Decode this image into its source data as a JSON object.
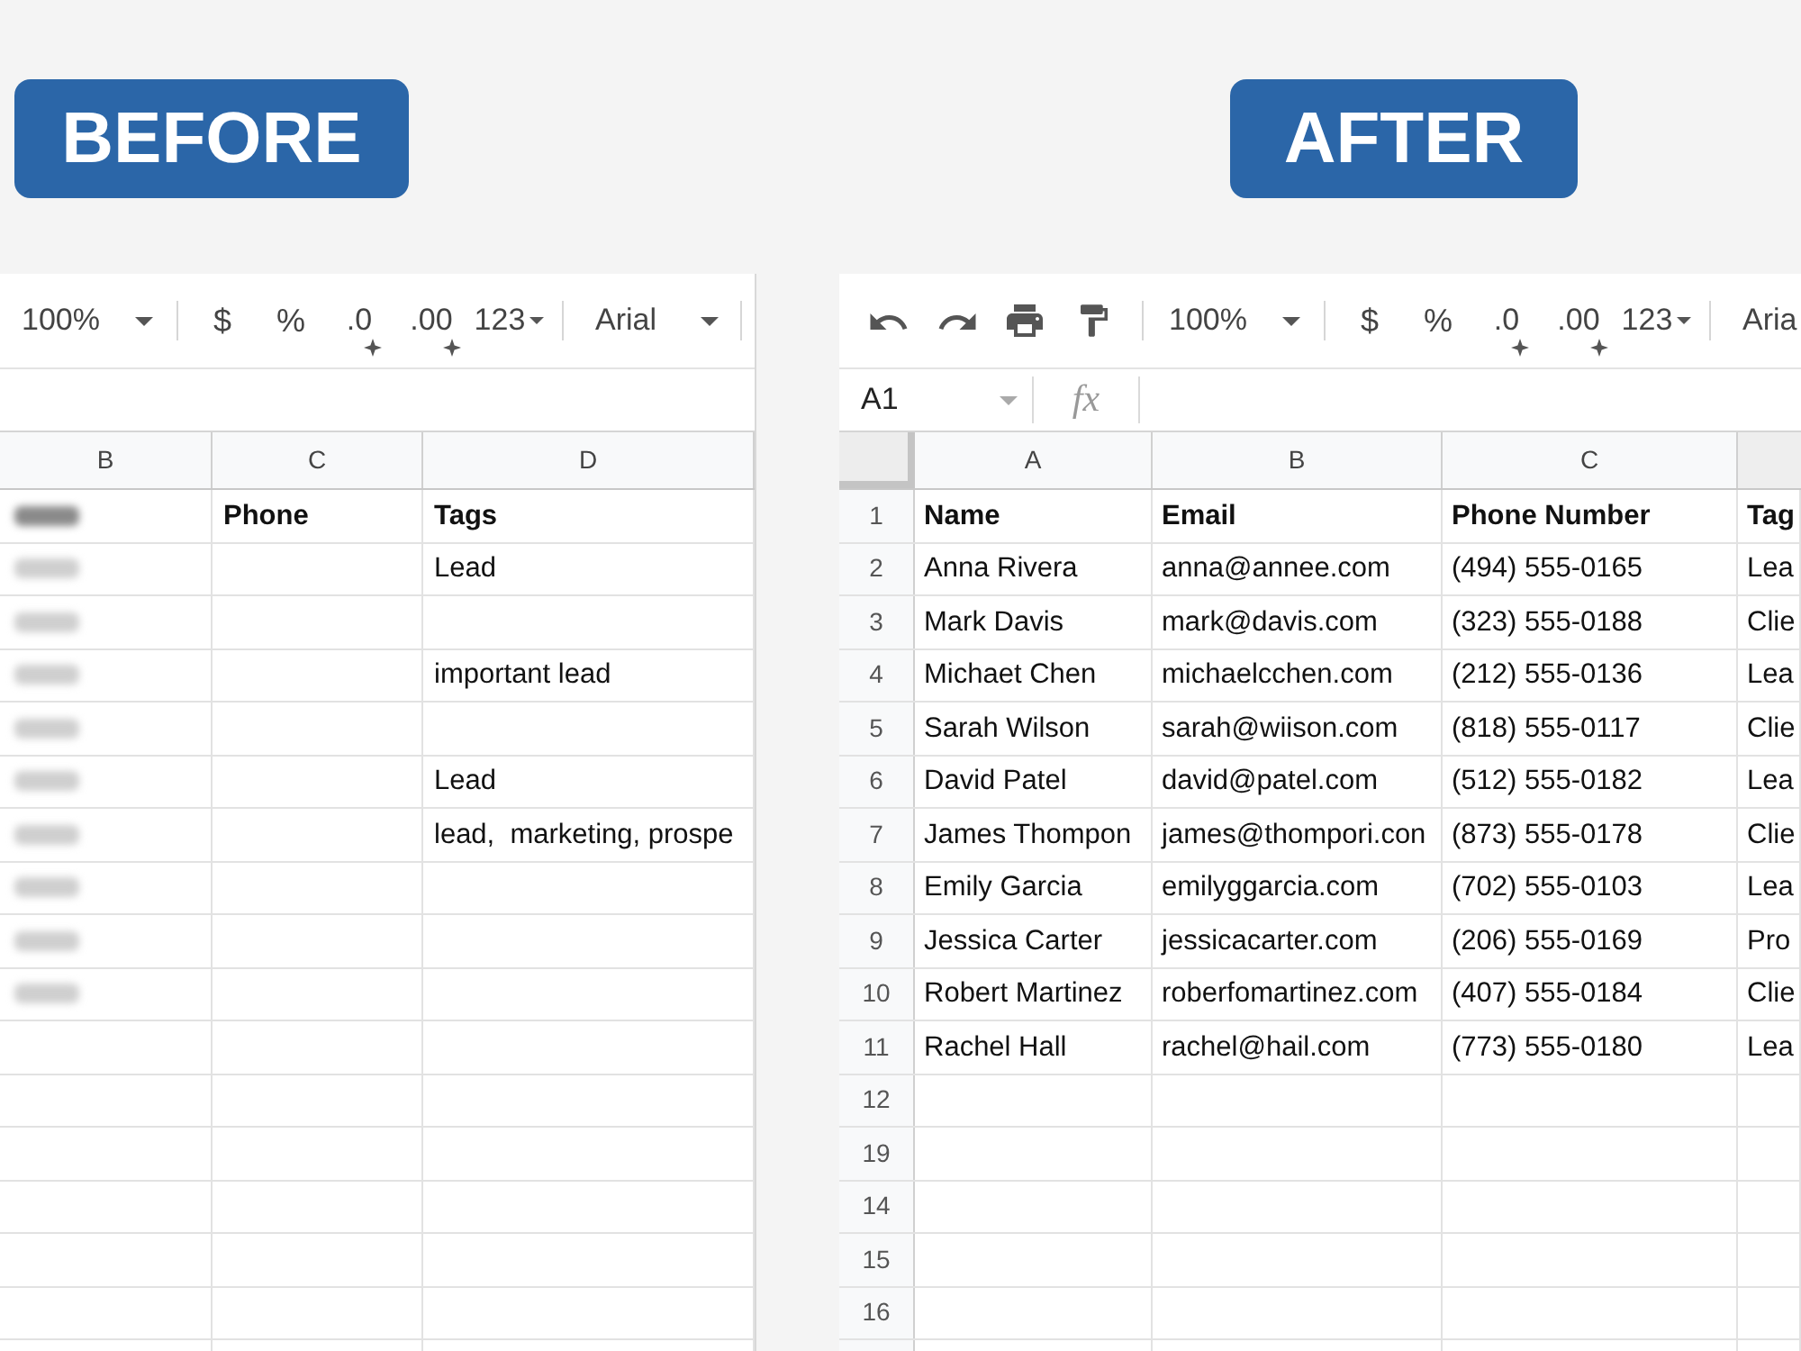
{
  "before": {
    "badge": "BEFORE",
    "toolbar": [
      {
        "kind": "zoom",
        "label": "100%",
        "caret": true
      },
      {
        "kind": "separator"
      },
      {
        "kind": "currency",
        "label": "$"
      },
      {
        "kind": "percent",
        "label": "%"
      },
      {
        "kind": "decrease_decimals",
        "label": ".0"
      },
      {
        "kind": "increase_decimals",
        "label": ".00"
      },
      {
        "kind": "number_format",
        "label": "123"
      },
      {
        "kind": "separator"
      },
      {
        "kind": "font",
        "label": "Arial",
        "caret": true
      },
      {
        "kind": "separator"
      }
    ],
    "columns": [
      "B",
      "C",
      "D"
    ],
    "rows": [
      {
        "bold": true,
        "cells": [
          {
            "kind": "blurred"
          },
          {
            "kind": "text",
            "text": "Phone"
          },
          {
            "kind": "text",
            "text": "Tags"
          }
        ]
      },
      {
        "bold": false,
        "cells": [
          {
            "kind": "blurred"
          },
          {
            "kind": "empty"
          },
          {
            "kind": "text",
            "text": "Lead"
          }
        ]
      },
      {
        "bold": false,
        "cells": [
          {
            "kind": "blurred"
          },
          {
            "kind": "empty"
          },
          {
            "kind": "empty"
          }
        ]
      },
      {
        "bold": false,
        "cells": [
          {
            "kind": "blurred"
          },
          {
            "kind": "empty"
          },
          {
            "kind": "text",
            "text": "important lead"
          }
        ]
      },
      {
        "bold": false,
        "cells": [
          {
            "kind": "blurred"
          },
          {
            "kind": "empty"
          },
          {
            "kind": "empty"
          }
        ]
      },
      {
        "bold": false,
        "cells": [
          {
            "kind": "blurred"
          },
          {
            "kind": "empty"
          },
          {
            "kind": "text",
            "text": "Lead"
          }
        ]
      },
      {
        "bold": false,
        "cells": [
          {
            "kind": "blurred"
          },
          {
            "kind": "empty"
          },
          {
            "kind": "text",
            "text": "lead,  marketing, prospe"
          }
        ]
      },
      {
        "bold": false,
        "cells": [
          {
            "kind": "blurred"
          },
          {
            "kind": "empty"
          },
          {
            "kind": "empty"
          }
        ]
      },
      {
        "bold": false,
        "cells": [
          {
            "kind": "blurred"
          },
          {
            "kind": "empty"
          },
          {
            "kind": "empty"
          }
        ]
      },
      {
        "bold": false,
        "cells": [
          {
            "kind": "blurred"
          },
          {
            "kind": "empty"
          },
          {
            "kind": "empty"
          }
        ]
      },
      {
        "cells": [
          {
            "kind": "empty"
          },
          {
            "kind": "empty"
          },
          {
            "kind": "empty"
          }
        ]
      },
      {
        "cells": [
          {
            "kind": "empty"
          },
          {
            "kind": "empty"
          },
          {
            "kind": "empty"
          }
        ]
      },
      {
        "cells": [
          {
            "kind": "empty"
          },
          {
            "kind": "empty"
          },
          {
            "kind": "empty"
          }
        ]
      },
      {
        "cells": [
          {
            "kind": "empty"
          },
          {
            "kind": "empty"
          },
          {
            "kind": "empty"
          }
        ]
      },
      {
        "cells": [
          {
            "kind": "empty"
          },
          {
            "kind": "empty"
          },
          {
            "kind": "empty"
          }
        ]
      },
      {
        "cells": [
          {
            "kind": "empty"
          },
          {
            "kind": "empty"
          },
          {
            "kind": "empty"
          }
        ]
      }
    ]
  },
  "after": {
    "badge": "AFTER",
    "toolbar": [
      {
        "kind": "undo"
      },
      {
        "kind": "redo"
      },
      {
        "kind": "print"
      },
      {
        "kind": "paint_format"
      },
      {
        "kind": "separator"
      },
      {
        "kind": "zoom",
        "label": "100%",
        "caret": true
      },
      {
        "kind": "separator"
      },
      {
        "kind": "currency",
        "label": "$"
      },
      {
        "kind": "percent",
        "label": "%"
      },
      {
        "kind": "decrease_decimals",
        "label": ".0"
      },
      {
        "kind": "increase_decimals",
        "label": ".00"
      },
      {
        "kind": "number_format",
        "label": "123"
      },
      {
        "kind": "separator"
      },
      {
        "kind": "font",
        "label": "Aria",
        "caret": false
      }
    ],
    "formula_bar": {
      "cell": "A1",
      "function_symbol": "fx"
    },
    "columns": [
      "A",
      "B",
      "C"
    ],
    "rows": [
      {
        "number": "1",
        "bold": true,
        "cells": [
          "Name",
          "Email",
          "Phone Number",
          "Tag"
        ]
      },
      {
        "number": "2",
        "bold": false,
        "cells": [
          "Anna Rivera",
          "anna@annee.com",
          "(494) 555-0165",
          "Lea"
        ]
      },
      {
        "number": "3",
        "bold": false,
        "cells": [
          "Mark Davis",
          "mark@davis.com",
          "(323) 555-0188",
          "Clie"
        ]
      },
      {
        "number": "4",
        "bold": false,
        "cells": [
          "Michaet Chen",
          "michaelcchen.com",
          "(212) 555-0136",
          "Lea"
        ]
      },
      {
        "number": "5",
        "bold": false,
        "cells": [
          "Sarah Wilson",
          "sarah@wiison.com",
          "(818) 555-0117",
          "Clie"
        ]
      },
      {
        "number": "6",
        "bold": false,
        "cells": [
          "David Patel",
          "david@patel.com",
          "(512) 555-0182",
          "Lea"
        ]
      },
      {
        "number": "7",
        "bold": false,
        "cells": [
          "James Thompon",
          "james@thompori.con",
          "(873) 555-0178",
          "Clie"
        ]
      },
      {
        "number": "8",
        "bold": false,
        "cells": [
          "Emily Garcia",
          "emilyggarcia.com",
          "(702) 555-0103",
          "Lea"
        ]
      },
      {
        "number": "9",
        "bold": false,
        "cells": [
          "Jessica Carter",
          "jessicacarter.com",
          "(206) 555-0169",
          "Pro"
        ]
      },
      {
        "number": "10",
        "bold": false,
        "cells": [
          "Robert Martinez",
          "roberfomartinez.com",
          "(407) 555-0184",
          "Clie"
        ]
      },
      {
        "number": "11",
        "bold": false,
        "cells": [
          "Rachel Hall",
          "rachel@hail.com",
          "(773) 555-0180",
          "Lea"
        ]
      },
      {
        "number": "12"
      },
      {
        "number": "19"
      },
      {
        "number": "14"
      },
      {
        "number": "15"
      },
      {
        "number": "16"
      }
    ]
  }
}
